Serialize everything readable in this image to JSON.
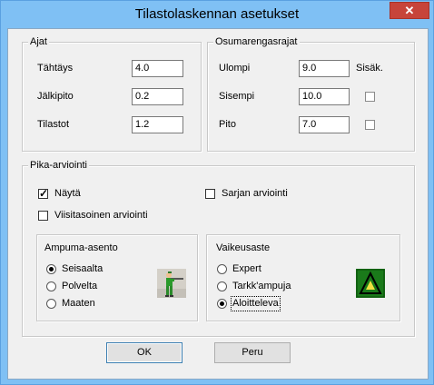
{
  "window": {
    "title": "Tilastolaskennan asetukset",
    "close_glyph": "✕"
  },
  "ajat": {
    "legend": "Ajat",
    "rows": [
      {
        "label": "Tähtäys",
        "value": "4.0"
      },
      {
        "label": "Jälkipito",
        "value": "0.2"
      },
      {
        "label": "Tilastot",
        "value": "1.2"
      }
    ]
  },
  "osuma": {
    "legend": "Osumarengasrajat",
    "rows": [
      {
        "label": "Ulompi",
        "value": "9.0"
      },
      {
        "label": "Sisempi",
        "value": "10.0"
      },
      {
        "label": "Pito",
        "value": "7.0"
      }
    ],
    "sisak_label": "Sisäk.",
    "sisak_checks": [
      false,
      false
    ]
  },
  "pika": {
    "legend": "Pika-arviointi",
    "nayta": {
      "label": "Näytä",
      "checked": true
    },
    "sarjan": {
      "label": "Sarjan arviointi",
      "checked": false
    },
    "viisi": {
      "label": "Viisitasoinen arviointi",
      "checked": false
    },
    "ampuma": {
      "legend": "Ampuma-asento",
      "options": [
        "Seisaalta",
        "Polvelta",
        "Maaten"
      ],
      "selected": 0,
      "icon": "standing-shooter-icon"
    },
    "vaikeus": {
      "legend": "Vaikeusaste",
      "options": [
        "Expert",
        "Tarkk'ampuja",
        "Aloitteleva"
      ],
      "selected": 2,
      "icon": "difficulty-icon"
    }
  },
  "buttons": {
    "ok": "OK",
    "peru": "Peru"
  },
  "colors": {
    "frame": "#7fc0f4",
    "close": "#c7443a",
    "client": "#f0f0f0"
  }
}
